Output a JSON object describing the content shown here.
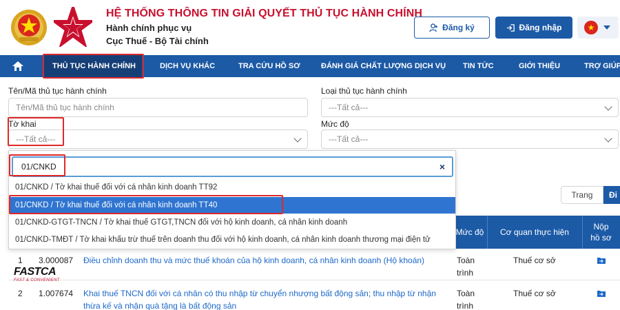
{
  "header": {
    "title": "HỆ THỐNG THÔNG TIN GIẢI QUYẾT THỦ TỤC HÀNH CHÍNH",
    "subtitle_1": "Hành chính phục vụ",
    "subtitle_2": "Cục Thuế - Bộ Tài chính",
    "register_label": "Đăng ký",
    "login_label": "Đăng nhập",
    "language_flag": "vietnam-flag",
    "colors": {
      "title": "#c8102e",
      "primary": "#1c5aa6"
    }
  },
  "nav": {
    "items": [
      "THỦ TỤC HÀNH CHÍNH",
      "DỊCH VỤ KHÁC",
      "TRA CỨU HỒ SƠ",
      "ĐÁNH GIÁ CHẤT LƯỢNG DỊCH VỤ",
      "TIN TỨC",
      "GIỚI THIỆU",
      "TRỢ GIÚP"
    ],
    "active_index": 0
  },
  "filters": {
    "procedure_name_label": "Tên/Mã thủ tục hành chính",
    "procedure_name_placeholder": "Tên/Mã thủ tục hành chính",
    "procedure_type_label": "Loại thủ tục hành chính",
    "procedure_type_value": "---Tất cả---",
    "declaration_label": "Tờ khai",
    "declaration_value": "---Tất cả---",
    "level_label": "Mức độ",
    "level_value": "---Tất cả---"
  },
  "dropdown": {
    "search_value": "01/CNKD",
    "options": [
      "01/CNKD / Tờ khai thuế đối với cá nhân kinh doanh TT92",
      "01/CNKD / Tờ khai thuế đối với cá nhân kinh doanh TT40",
      "01/CNKD-GTGT-TNCN / Tờ khai thuế GTGT,TNCN đối với hộ kinh doanh, cá nhân kinh doanh",
      "01/CNKD-TMĐT / Tờ khai khấu trừ thuế trên doanh thu đối với hộ kinh doanh, cá nhân kinh doanh thương mại điện tử"
    ],
    "selected_index": 1
  },
  "pagination": {
    "page_label": "Trang",
    "go_label": "Đi"
  },
  "table": {
    "headers": {
      "level": "Mức độ",
      "agency": "Cơ quan thực hiện",
      "submit": "Nộp hồ sơ"
    },
    "rows": [
      {
        "index": "1",
        "code": "3.000087",
        "name": "Điều chỉnh doanh thu và mức thuế khoán của hộ kinh doanh, cá nhân kinh doanh (Hộ khoán)",
        "level": "Toàn trình",
        "agency": "Thuế cơ sở"
      },
      {
        "index": "2",
        "code": "1.007674",
        "name": "Khai thuế TNCN đối với cá nhân có thu nhập từ chuyển nhượng bất động sản; thu nhập từ nhận thừa kế và nhận quà tặng là bất động sản",
        "level": "Toàn trình",
        "agency": "Thuế cơ sở"
      }
    ]
  },
  "watermark": {
    "brand": "FASTCA",
    "tagline": "FAST & CONVENIENT"
  }
}
